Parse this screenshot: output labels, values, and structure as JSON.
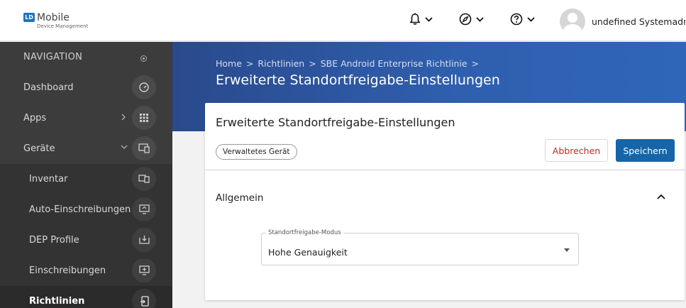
{
  "header": {
    "logo_mark": "LD",
    "logo_title": "Mobile",
    "logo_subtitle": "Device Management",
    "user_name": "undefined Systemadmi..."
  },
  "sidebar": {
    "nav_heading": "NAVIGATION",
    "items": [
      {
        "label": "Dashboard",
        "icon": "gauge-icon"
      },
      {
        "label": "Apps",
        "icon": "grid-icon"
      },
      {
        "label": "Geräte",
        "icon": "devices-icon"
      },
      {
        "label": "Inventar",
        "icon": "inventory-icon"
      },
      {
        "label": "Auto-Einschreibungen",
        "icon": "auto-enroll-icon"
      },
      {
        "label": "DEP Profile",
        "icon": "download-icon"
      },
      {
        "label": "Einschreibungen",
        "icon": "enroll-icon"
      },
      {
        "label": "Richtlinien",
        "icon": "policy-icon"
      }
    ]
  },
  "banner": {
    "breadcrumb": [
      "Home",
      "Richtlinien",
      "SBE Android Enterprise Richtlinie"
    ],
    "breadcrumb_sep": ">",
    "title": "Erweiterte Standortfreigabe-Einstellungen"
  },
  "card": {
    "title": "Erweiterte Standortfreigabe-Einstellungen",
    "chip": "Verwaltetes Gerät",
    "cancel_label": "Abbrechen",
    "save_label": "Speichern",
    "section_title": "Allgemein",
    "field_label": "Standortfreigabe-Modus",
    "field_value": "Hohe Genauigkeit"
  },
  "colors": {
    "primary": "#1565a8",
    "cancel_text": "#c62828",
    "sidebar_bg": "#3c3c3c",
    "banner": "#2f5fae"
  }
}
